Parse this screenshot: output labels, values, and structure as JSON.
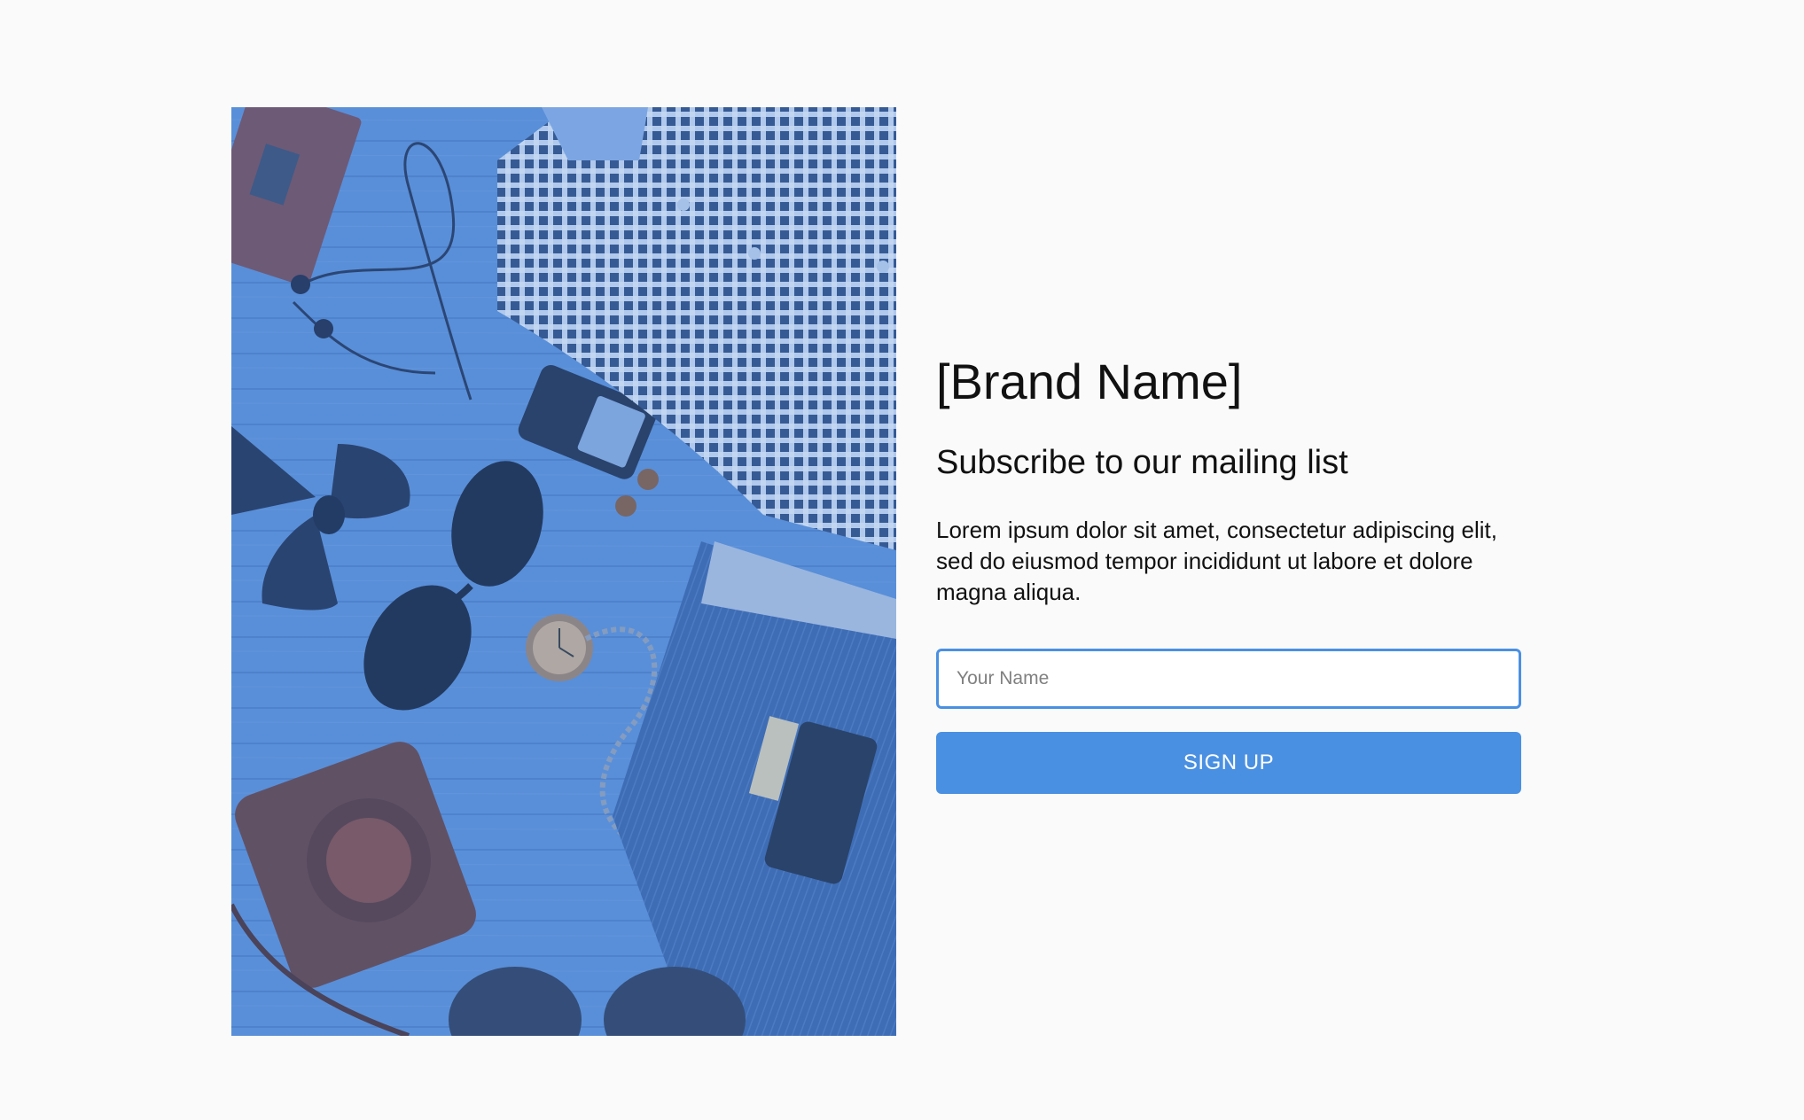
{
  "hero": {
    "overlay_color": "#4a86d8",
    "image_subject": "flat-lay of men's fashion accessories"
  },
  "brand": {
    "name": "[Brand Name]"
  },
  "subscribe": {
    "title": "Subscribe to our mailing list",
    "body": "Lorem ipsum dolor sit amet, consectetur adipiscing elit, sed do eiusmod tempor incididunt ut labore et dolore magna aliqua.",
    "name_placeholder": "Your Name",
    "name_value": "",
    "button_label": "SIGN UP"
  },
  "colors": {
    "accent": "#4a90e2",
    "background": "#fafafa",
    "text": "#111111"
  }
}
